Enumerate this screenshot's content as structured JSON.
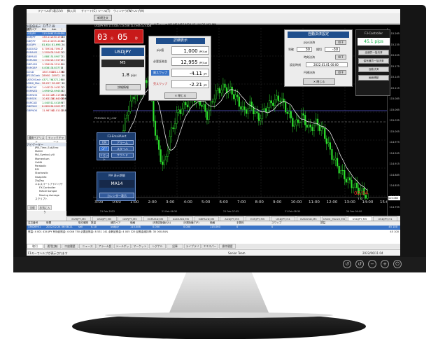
{
  "window": {
    "menu": [
      "ファイル(F)",
      "表示(V)",
      "挿入(I)",
      "チャート(C)",
      "ツール(T)",
      "ウィンドウ(W)",
      "ヘルプ(H)"
    ],
    "toolbar_order": "新規注文",
    "chart_title": "USDJPY,M5 113.028 113.036 112.965 113.028"
  },
  "market_watch": {
    "header": "気配値表示: 22:57:38",
    "columns": [
      "通貨ペア",
      "Bid",
      "Ask",
      "!"
    ],
    "rows": [
      {
        "sym": "USDJPY",
        "bid": "115.066",
        "ask": "115.060",
        "sp": "28"
      },
      {
        "sym": "EURJPY",
        "bid": "130.112",
        "ask": "130.150",
        "sp": "33"
      },
      {
        "sym": "GBPJPY",
        "bid": "155.412",
        "ask": "155.466",
        "sp": "38"
      },
      {
        "sym": "AUDJPY",
        "bid": "81.614",
        "ask": "81.698",
        "sp": "24"
      },
      {
        "sym": "AUDUSD",
        "bid": "0.70934",
        "ask": "0.70942",
        "sp": "7"
      },
      {
        "sym": "EURAUD",
        "bid": "1.59263",
        "ask": "1.59412",
        "sp": "12"
      },
      {
        "sym": "GBPAUD",
        "bid": "1.88815",
        "ask": "1.89077",
        "sp": "21"
      },
      {
        "sym": "EURUSD",
        "bid": "1.13122",
        "ask": "1.13170",
        "sp": "21"
      },
      {
        "sym": "GBPUSD",
        "bid": "1.35899",
        "ask": "1.35118",
        "sp": "20"
      },
      {
        "sym": "EURGBP",
        "bid": "0.83813",
        "ask": "0.83771",
        "sp": "8"
      },
      {
        "sym": "GOLD",
        "bid": "1807.600",
        "ask": "1811.540",
        "sp": "90"
      },
      {
        "sym": "JP225Cash",
        "bid": "28950",
        "ask": "28972",
        "sp": "10"
      },
      {
        "sym": "US500Cash",
        "bid": "4371.76",
        "ask": "4372.26",
        "sp": "50"
      },
      {
        "sym": "USDX_Mar..",
        "bid": "96.257",
        "ask": "96.287",
        "sp": "30"
      },
      {
        "sym": "EURCHF",
        "bid": "1.04322",
        "ask": "1.04327",
        "sp": "12"
      },
      {
        "sym": "EURNZD",
        "bid": "1.69392",
        "ask": "1.69454",
        "sp": "32"
      },
      {
        "sym": "EURNOK",
        "bid": "10.10127",
        "ask": "10.11959",
        "sp": "201"
      },
      {
        "sym": "EURSEK",
        "bid": "10.63134",
        "ask": "10.64006",
        "sp": "236"
      },
      {
        "sym": "EURCAD",
        "bid": "1.44051",
        "ask": "1.44189",
        "sp": "37"
      },
      {
        "sym": "GBPDKK",
        "bid": "8.88281",
        "ask": "8.89053",
        "sp": "77"
      },
      {
        "sym": "GBPNOK",
        "bid": "11.98744",
        "ask": "12.01102",
        "sp": "218"
      }
    ],
    "tabs": [
      "通貨ペアリスト",
      "ティックチャート"
    ]
  },
  "navigator": {
    "header": "ナビゲーター",
    "items": [
      "JPN_Time_SubZero",
      "MACD",
      "MA_Symbol_v4i",
      "Momentum",
      "OsMA",
      "Parabolic",
      "RSI",
      "Stochastic",
      "Swapinfo",
      "ZigZag",
      "エキスパートアドバイザ",
      "FX-Controller",
      "MACD Sample",
      "Moving Average",
      "スクリプト"
    ],
    "tabs": [
      "全般",
      "お気に入り"
    ]
  },
  "chart": {
    "countdown": "03",
    "countdown_sec": "05",
    "countdown_min": "分",
    "countdown_s_label": "秒",
    "symbol_panel": {
      "symbol": "USDJPY",
      "timeframe": "M5",
      "spread": "1.8",
      "spread_unit": "pips",
      "detail_btn": "詳細情報"
    },
    "detail_panel": {
      "title": "詳細表示",
      "rows": [
        {
          "label": "pip値",
          "value": "1,000",
          "unit": "JPY/Lot"
        },
        {
          "label": "必要証拠金",
          "value": "12,955",
          "unit": "JPY/Lot"
        },
        {
          "label": "買スワップ",
          "value": "-4.11",
          "unit": "JPY"
        },
        {
          "label": "売スワップ",
          "value": "-2.21",
          "unit": "JPY"
        }
      ],
      "close_btn": "閉じる"
    },
    "autoclose_panel": {
      "title": "自動決済設定",
      "pips_label": "pips決済",
      "pips_toggle": "OFF",
      "profit_label": "利確",
      "profit_val": "30",
      "loss_label": "損切",
      "loss_val": "-30",
      "time_label": "時刻決済",
      "time_toggle": "OFF",
      "set_label": "設定時刻",
      "set_val": "2022.01.01 00:00",
      "amount_label": "円建決済",
      "amount_toggle": "OFF",
      "close_btn": "閉じる"
    },
    "controller_panel": {
      "title": "F3-Controller",
      "pips": "45.1 pips",
      "buttons": [
        "全通貨一括決済",
        "保有通貨一括決済",
        "自動決済",
        "画面移動"
      ]
    },
    "email_panel": {
      "title": "F3-EmailAlert",
      "btns": [
        "ON",
        "アラーム",
        "OFF",
        "スタイル",
        "リセット",
        "テンプレ",
        "サウンド"
      ]
    },
    "ma_panel": {
      "title": "MA 表示期間",
      "value": "MA14",
      "btn": "カレンダー表示"
    },
    "price_labels": [
      "115.265",
      "115.235",
      "115.205",
      "115.175",
      "115.145",
      "115.115",
      "115.085",
      "115.065",
      "115.035",
      "115.005",
      "114.975",
      "114.945",
      "114.915",
      "114.885",
      "114.855",
      "114.825",
      "114.795"
    ],
    "current_price": "115.060",
    "time_labels": [
      "3:00",
      "0:00",
      "1:00",
      "2:00",
      "3:00",
      "4:00",
      "5:00",
      "6:00",
      "7:00",
      "8:00",
      "9:00",
      "10:00",
      "11:00",
      "12:00",
      "13:00",
      "14:00",
      "15:00"
    ],
    "date_labels": [
      "21 Feb 2022",
      "21 Feb 06:30",
      "21 Feb 07:05",
      "21 Feb 08:30",
      "24 Feb 09:00"
    ],
    "candle_end_label": "02:04",
    "candle_end_sub": "1.8",
    "prevday_label": "PREVDAY HI_LOW",
    "tabs": [
      "EURJPY,M5",
      "USDJPY,M5",
      "GBPJPY,M5",
      "EURUSD,M5",
      "AUDUSD,M5",
      "GBPAUD,M5",
      "AUDJPY,M5",
      "EURJPY,M5",
      "USDJPY,H4",
      "NZDUSD,M5",
      "USDX_Mar22,M5",
      "USDJPY,M5",
      "USDJPY,H1"
    ]
  },
  "terminal": {
    "columns": [
      "注文番号",
      "時間",
      "取引種別",
      "数量",
      "通貨ペア",
      "価格",
      "決済逆指値(S/L)",
      "決済指値(T/P)",
      "価格",
      "手数料",
      "スワップ",
      "損益"
    ],
    "row": {
      "ticket": "33626951",
      "time": "2022.02.24 06:08:21",
      "type": "sell",
      "lots": "0.10",
      "symbol": "usdjpy",
      "price": "115.088",
      "sl": "0.000",
      "tp": "0.000",
      "cur": "115.060",
      "fee": "0",
      "swap": "0",
      "profit": "45 100"
    },
    "balance": "残高: 4 001 434 JPY 有効証拠金: 4 046 750 必要証拠金: 8 531 141 余剰証拠金: 4 005 325 証拠金維持率: 35 000.84%",
    "total": "45 100",
    "tabs": [
      "取引",
      "運用比較",
      "口座履歴",
      "ニュース",
      "アラーム設定",
      "メールボックス",
      "マーケット",
      "シグナル",
      "記事",
      "ライブラリ",
      "エキスパート",
      "操作履歴"
    ]
  },
  "status": {
    "help": "F1キーでヘルプが表示されます",
    "profile": "Senior Team",
    "datetime": "2022/06/11 04"
  }
}
